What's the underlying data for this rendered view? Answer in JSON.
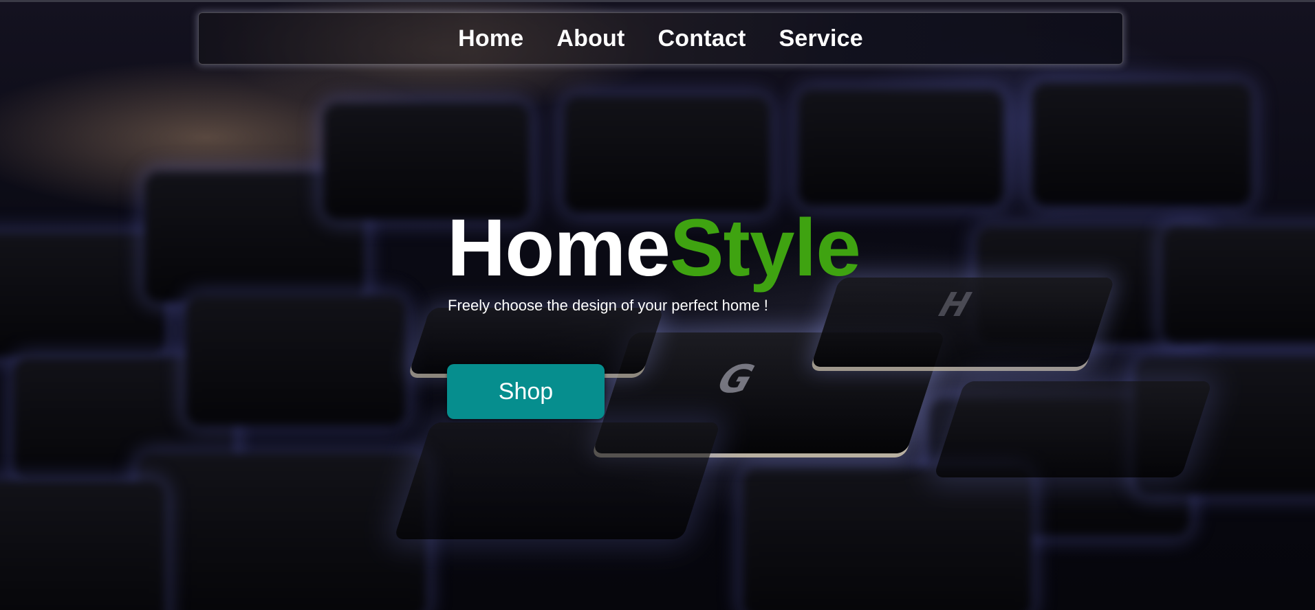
{
  "nav": {
    "items": [
      {
        "label": "Home"
      },
      {
        "label": "About"
      },
      {
        "label": "Contact"
      },
      {
        "label": "Service"
      }
    ]
  },
  "hero": {
    "brand_first": "Home",
    "brand_second": "Style",
    "tagline": "Freely choose the design of your perfect home !",
    "shop_label": "Shop"
  },
  "colors": {
    "brand_green": "#3fa311",
    "button_teal": "#068e8e",
    "text_white": "#ffffff"
  }
}
